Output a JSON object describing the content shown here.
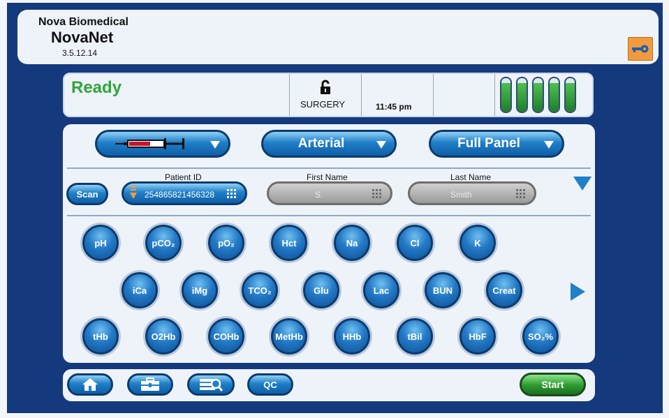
{
  "header": {
    "company": "Nova Biomedical",
    "product": "NovaNet",
    "version": "3.5.12.14",
    "key_icon": "key-icon"
  },
  "status": {
    "state": "Ready",
    "lock_icon": "unlock-icon",
    "location": "SURGERY",
    "time": "11:45 pm",
    "reagent_levels": [
      0.85,
      0.85,
      0.85,
      0.85,
      0.85
    ],
    "colors": {
      "ready": "#2fa63a",
      "level": "#2c9a2f"
    }
  },
  "sample": {
    "sample_type_icon": "syringe-icon",
    "sample_site": "Arterial",
    "panel": "Full Panel"
  },
  "patient": {
    "scan_label": "Scan",
    "patient_id_label": "Patient ID",
    "patient_id_value": "254865821456328",
    "first_name_label": "First Name",
    "first_name_value": "S.",
    "last_name_label": "Last Name",
    "last_name_value": "Smith"
  },
  "analytes": {
    "row1": [
      "pH",
      "pCO₂",
      "pO₂",
      "Hct",
      "Na",
      "Cl",
      "K"
    ],
    "row2": [
      "iCa",
      "iMg",
      "TCO₂",
      "Glu",
      "Lac",
      "BUN",
      "Creat"
    ],
    "row3": [
      "tHb",
      "O2Hb",
      "COHb",
      "MetHb",
      "HHb",
      "tBil",
      "HbF",
      "SO₂%"
    ]
  },
  "bottom": {
    "home_icon": "home-icon",
    "toolbox_icon": "toolbox-icon",
    "search_icon": "search-records-icon",
    "qc_label": "QC",
    "start_label": "Start"
  }
}
